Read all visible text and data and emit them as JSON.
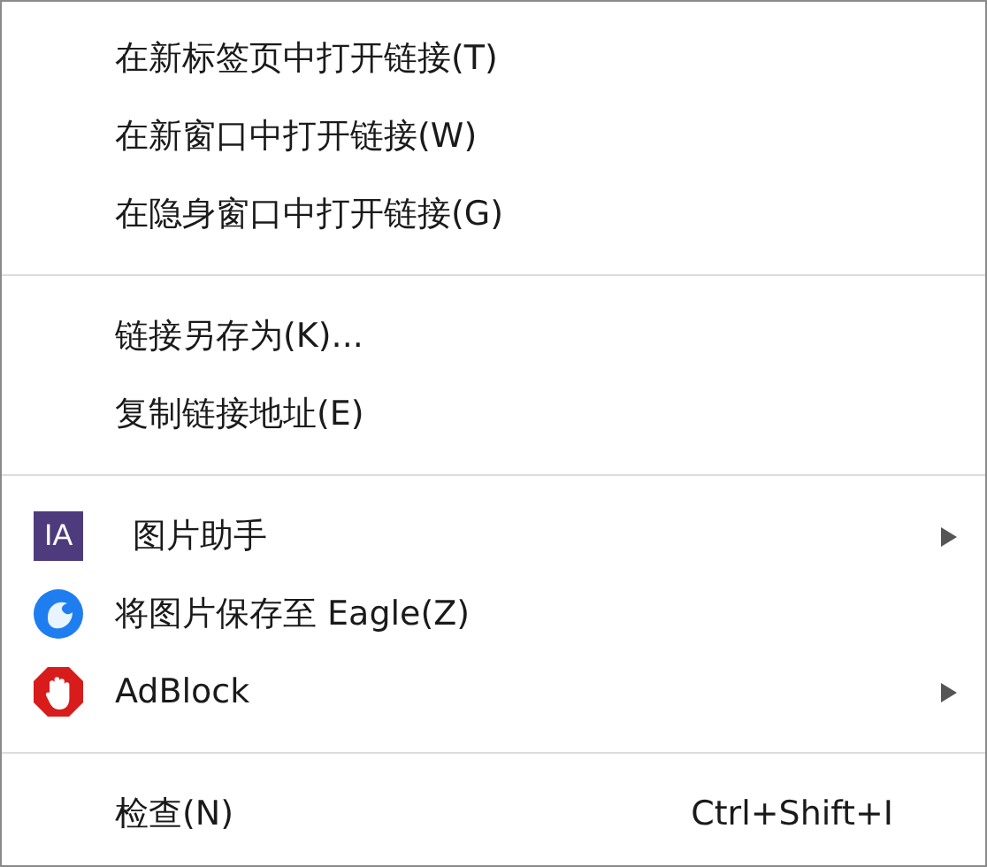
{
  "menu": {
    "groups": [
      {
        "items": [
          {
            "label": "在新标签页中打开链接(T)",
            "submenu": false
          },
          {
            "label": "在新窗口中打开链接(W)",
            "submenu": false
          },
          {
            "label": "在隐身窗口中打开链接(G)",
            "submenu": false
          }
        ]
      },
      {
        "items": [
          {
            "label": "链接另存为(K)...",
            "submenu": false
          },
          {
            "label": "复制链接地址(E)",
            "submenu": false
          }
        ]
      },
      {
        "items": [
          {
            "label": "图片助手",
            "icon": {
              "kind": "ia",
              "text": "IA"
            },
            "submenu": true
          },
          {
            "label": "将图片保存至 Eagle(Z)",
            "icon": {
              "kind": "eagle"
            },
            "submenu": false
          },
          {
            "label": "AdBlock",
            "icon": {
              "kind": "adblock"
            },
            "submenu": true
          }
        ]
      },
      {
        "items": [
          {
            "label": "检查(N)",
            "shortcut": "Ctrl+Shift+I",
            "submenu": false
          }
        ]
      }
    ]
  }
}
